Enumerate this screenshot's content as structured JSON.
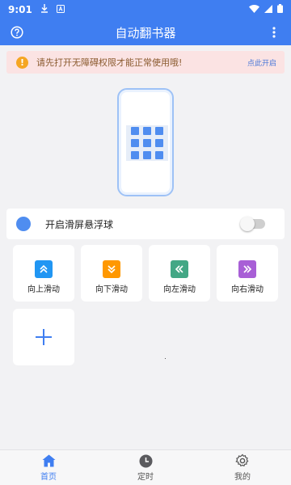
{
  "status_bar": {
    "time": "9:01"
  },
  "app_bar": {
    "title": "自动翻书器"
  },
  "notice": {
    "text": "请先打开无障碍权限才能正常使用哦!",
    "action": "点此开启"
  },
  "floating_ball": {
    "label": "开启滑屏悬浮球",
    "enabled": false
  },
  "actions": [
    {
      "label": "向上滑动",
      "color": "#2196f3",
      "icon": "double-chevron-up-icon"
    },
    {
      "label": "向下滑动",
      "color": "#ff9800",
      "icon": "double-chevron-down-icon"
    },
    {
      "label": "向左滑动",
      "color": "#43a785",
      "icon": "double-chevron-left-icon"
    },
    {
      "label": "向右滑动",
      "color": "#a85fd6",
      "icon": "double-chevron-right-icon"
    }
  ],
  "bottom_nav": [
    {
      "label": "首页",
      "icon": "home-icon",
      "active": true
    },
    {
      "label": "定时",
      "icon": "clock-icon",
      "active": false
    },
    {
      "label": "我的",
      "icon": "gear-icon",
      "active": false
    }
  ],
  "colors": {
    "primary": "#3f7ef1",
    "accent_blue": "#4f8df0",
    "notice_bg": "#fbe3e3"
  }
}
